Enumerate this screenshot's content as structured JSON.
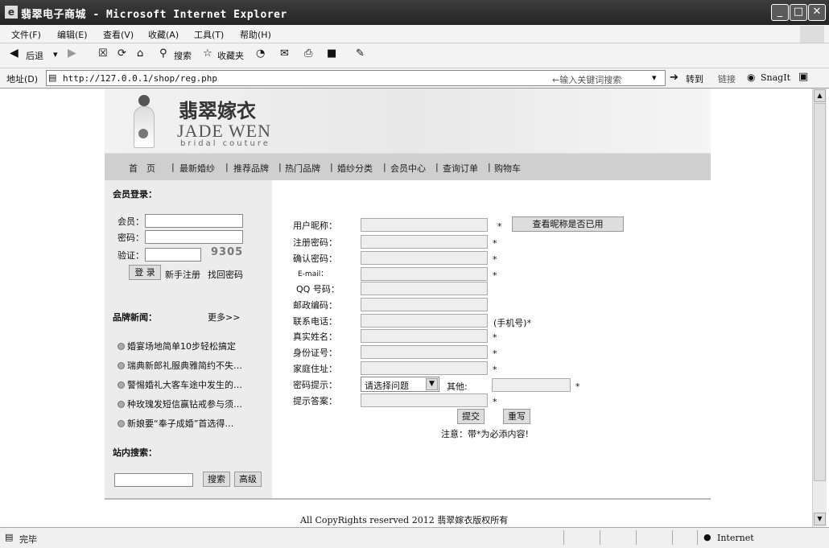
{
  "window": {
    "title": "翡翠电子商城 - Microsoft Internet Explorer",
    "min": "_",
    "max": "□",
    "close": "✕"
  },
  "menu": [
    "文件(F)",
    "编辑(E)",
    "查看(V)",
    "收藏(A)",
    "工具(T)",
    "帮助(H)"
  ],
  "toolbar": {
    "back": "后退",
    "search": "搜索",
    "favorites": "收藏夹"
  },
  "address": {
    "label": "地址(D)",
    "url": "http://127.0.0.1/shop/reg.php",
    "keyword_hint": "←输入关键词搜索",
    "go": "转到",
    "links": "链接",
    "snagit": "SnagIt"
  },
  "brand": {
    "name_cn": "翡翠嫁衣",
    "name_en": "JADE WEN",
    "tagline": "bridal couture"
  },
  "nav": [
    "首　页",
    "最新婚纱",
    "推荐品牌",
    "热门品牌",
    "婚纱分类",
    "会员中心",
    "查询订单",
    "购物车"
  ],
  "login": {
    "title": "会员登录：",
    "member": "会员：",
    "password": "密码：",
    "captcha": "验证：",
    "captcha_code": "9305",
    "login_btn": "登 录",
    "register": "新手注册",
    "recover": "找回密码"
  },
  "news": {
    "title": "品牌新闻：",
    "more": "更多>>",
    "items": [
      "婚宴场地简单10步轻松搞定",
      "瑞典新郎礼服典雅简约不失…",
      "警惕婚礼大客车途中发生的…",
      "种玫瑰发短信赢钻戒参与须…",
      "新娘要“奉子成婚”首选得…"
    ]
  },
  "site_search": {
    "title": "站内搜索：",
    "search_btn": "搜索",
    "advanced_btn": "高级"
  },
  "form": {
    "nickname": "用户昵称：",
    "check_btn": "查看昵称是否已用",
    "password": "注册密码：",
    "confirm": "确认密码：",
    "email": "E-mail：",
    "qq": "QQ 号码：",
    "postcode": "邮政编码：",
    "phone": "联系电话：",
    "phone_note": "(手机号)*",
    "realname": "真实姓名：",
    "idcard": "身份证号：",
    "address": "家庭住址：",
    "question": "密码提示：",
    "question_default": "请选择问题",
    "other": "其他:",
    "answer": "提示答案：",
    "submit": "提交",
    "reset": "重写",
    "note": "注意：带*为必添内容!",
    "required": "*"
  },
  "footer": {
    "copyright": "All CopyRights reserved 2012 翡翠嫁衣版权所有"
  },
  "status": {
    "done": "完毕",
    "zone": "Internet"
  }
}
